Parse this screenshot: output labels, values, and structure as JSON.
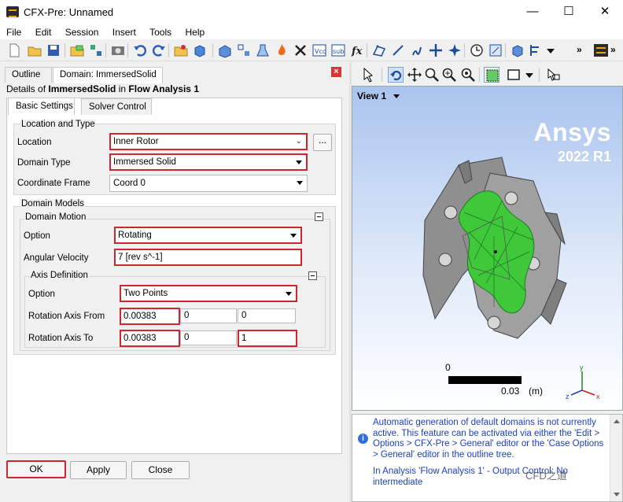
{
  "window": {
    "title": "CFX-Pre:  Unnamed"
  },
  "menu": [
    "File",
    "Edit",
    "Session",
    "Insert",
    "Tools",
    "Help"
  ],
  "left_panel": {
    "tabs": [
      "Outline",
      "Domain: ImmersedSolid"
    ],
    "details_prefix": "Details of ",
    "details_object": "ImmersedSolid",
    "details_middle": " in ",
    "details_parent": "Flow Analysis 1",
    "subtabs": [
      "Basic Settings",
      "Solver Control"
    ],
    "location_and_type": {
      "title": "Location and Type",
      "location_label": "Location",
      "location_value": "Inner Rotor",
      "location_browse": "...",
      "domain_type_label": "Domain Type",
      "domain_type_value": "Immersed Solid",
      "coord_frame_label": "Coordinate Frame",
      "coord_frame_value": "Coord 0"
    },
    "domain_models": {
      "title": "Domain Models",
      "motion_title": "Domain Motion",
      "option_label": "Option",
      "option_value": "Rotating",
      "angular_velocity_label": "Angular Velocity",
      "angular_velocity_value": "7 [rev s^-1]",
      "axis_definition": {
        "title": "Axis Definition",
        "option_label": "Option",
        "option_value": "Two Points",
        "from_label": "Rotation Axis From",
        "from_values": [
          "0.00383",
          "0",
          "0"
        ],
        "to_label": "Rotation Axis To",
        "to_values": [
          "0.00383",
          "0",
          "1"
        ]
      }
    },
    "buttons": {
      "ok": "OK",
      "apply": "Apply",
      "close": "Close"
    }
  },
  "viewer": {
    "view_label": "View 1",
    "brand": "Ansys",
    "version": "2022 R1",
    "scale_start": "0",
    "scale_end": "0.03",
    "scale_unit": "(m)",
    "axes": {
      "x": "x",
      "y": "y",
      "z": "z"
    }
  },
  "messages": {
    "text": "Automatic generation of default domains is not currently active. This feature can be activated via either the 'Edit > Options > CFX-Pre > General' editor or the 'Case Options > General' editor in the outline tree.",
    "text2": "In Analysis 'Flow Analysis 1' - Output Control: No intermediate"
  },
  "watermark": "CFD之道",
  "colors": {
    "highlight_red": "#d0242f",
    "solid_green": "#3ec83a",
    "body_grey": "#9a9a9a"
  }
}
